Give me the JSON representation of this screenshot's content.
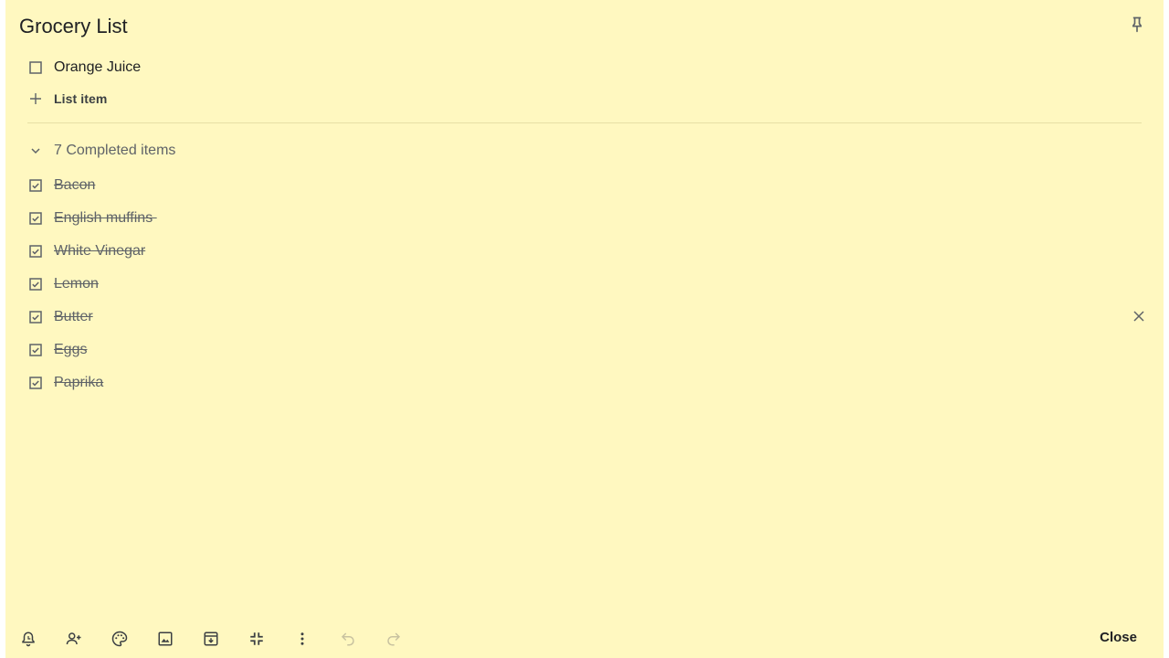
{
  "note": {
    "title": "Grocery List",
    "colors": {
      "background": "#fff8c0",
      "text": "#202124",
      "muted": "#5f6368"
    }
  },
  "header": {
    "pin_icon": "pin-icon"
  },
  "unchecked_items": [
    {
      "label": "Orange Juice",
      "checked": false
    }
  ],
  "add_item": {
    "label": "List item",
    "icon": "plus-icon"
  },
  "completed": {
    "header_label": "7 Completed items",
    "toggle_icon": "chevron-down-icon",
    "items": [
      {
        "label": "Bacon",
        "checked": true
      },
      {
        "label": "English muffins ",
        "checked": true
      },
      {
        "label": "White Vinegar",
        "checked": true
      },
      {
        "label": "Lemon",
        "checked": true
      },
      {
        "label": "Butter",
        "checked": true
      },
      {
        "label": "Eggs",
        "checked": true
      },
      {
        "label": "Paprika",
        "checked": true
      }
    ],
    "remove_icon": "close-icon"
  },
  "toolbar": {
    "buttons": [
      {
        "icon": "reminder-bell-icon"
      },
      {
        "icon": "collaborator-icon"
      },
      {
        "icon": "palette-icon"
      },
      {
        "icon": "image-icon"
      },
      {
        "icon": "archive-icon"
      },
      {
        "icon": "collapse-icon"
      },
      {
        "icon": "more-vert-icon"
      },
      {
        "icon": "undo-icon",
        "disabled": true
      },
      {
        "icon": "redo-icon",
        "disabled": true
      }
    ],
    "close_label": "Close"
  }
}
